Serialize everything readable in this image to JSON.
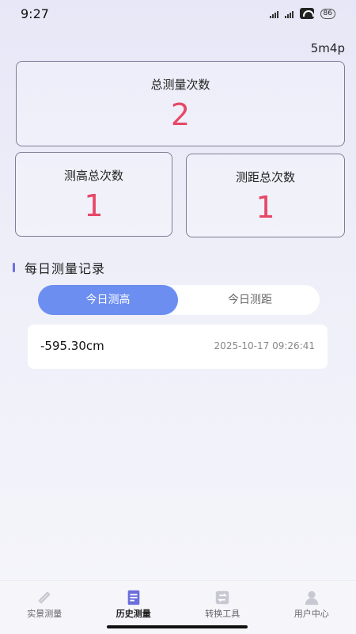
{
  "status": {
    "time": "9:27",
    "battery": "86"
  },
  "header": {
    "top_right": "5m4p"
  },
  "stats": {
    "total_title": "总测量次数",
    "total_value": "2",
    "height_title": "测高总次数",
    "height_value": "1",
    "distance_title": "测距总次数",
    "distance_value": "1"
  },
  "section": {
    "title": "每日测量记录"
  },
  "segments": {
    "today_height": "今日测高",
    "today_distance": "今日测距"
  },
  "records": [
    {
      "value": "-595.30cm",
      "time": "2025-10-17 09:26:41"
    }
  ],
  "tabs": [
    {
      "label": "实景测量",
      "icon": "ruler-icon"
    },
    {
      "label": "历史测量",
      "icon": "document-icon"
    },
    {
      "label": "转换工具",
      "icon": "convert-icon"
    },
    {
      "label": "用户中心",
      "icon": "user-icon"
    }
  ],
  "colors": {
    "accent": "#e74867",
    "primary": "#6c8ef0",
    "active_tab": "#6b6fdc"
  }
}
